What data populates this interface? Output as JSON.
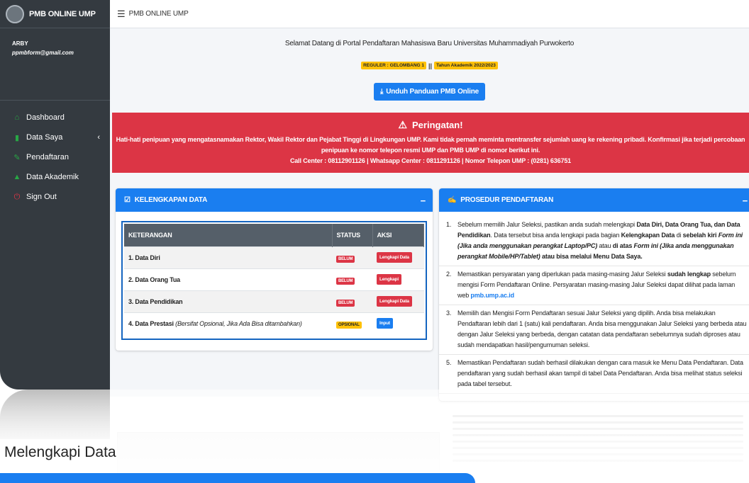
{
  "brand": {
    "title": "PMB ONLINE UMP"
  },
  "user": {
    "name": "ARBY",
    "email": "ppmbform@gmail.com"
  },
  "nav": [
    {
      "label": "Dashboard",
      "icon": "home-icon",
      "color": "#28a745"
    },
    {
      "label": "Data Saya",
      "icon": "book-icon",
      "color": "#28a745",
      "has_chevron": true
    },
    {
      "label": "Pendaftaran",
      "icon": "edit-icon",
      "color": "#28a745"
    },
    {
      "label": "Data Akademik",
      "icon": "graduation-cap-icon",
      "color": "#28a745"
    },
    {
      "label": "Sign Out",
      "icon": "power-icon",
      "color": "#dc3545"
    }
  ],
  "topbar": {
    "title": "PMB ONLINE UMP"
  },
  "welcome": "Selamat Datang di Portal Pendaftaran Mahasiswa Baru Universitas Muhammadiyah Purwokerto",
  "badges": {
    "left": "REGULER : GELOMBANG 1",
    "separator": "||",
    "right": "Tahun Akademik 2022/2023"
  },
  "download_button": "Unduh Panduan PMB Online",
  "warning": {
    "title": "Peringatan!",
    "line1": "Hati-hati penipuan yang mengatasnamakan Rektor, Wakil Rektor dan Pejabat Tinggi di Lingkungan UMP. Kami tidak pernah meminta mentransfer sejumlah uang ke rekening pribadi. Konfirmasi jika terjadi percobaan",
    "line2": "penipuan ke nomor telepon resmi UMP dan PMB UMP di nomor berikut ini.",
    "line3": "Call Center : 08112901126 | Whatsapp Center : 0811291126 | Nomor Telepon UMP : (0281) 636751"
  },
  "kelengkapan": {
    "title": "KELENGKAPAN DATA",
    "collapse": "−",
    "headers": {
      "keterangan": "KETERANGAN",
      "status": "STATUS",
      "aksi": "AKSI"
    },
    "rows": [
      {
        "label": "1. Data Diri",
        "note": "",
        "status": "BELUM",
        "status_type": "red",
        "action": "Lengkapi Data",
        "action_type": "red"
      },
      {
        "label": "2. Data Orang Tua",
        "note": "",
        "status": "BELUM",
        "status_type": "red",
        "action": "Lengkapi",
        "action_type": "red"
      },
      {
        "label": "3. Data Pendidikan",
        "note": "",
        "status": "BELUM",
        "status_type": "red",
        "action": "Lengkapi Data",
        "action_type": "red"
      },
      {
        "label": "4. Data Prestasi",
        "note": "(Bersifat Opsional, Jika Ada Bisa ditambahkan)",
        "status": "OPSIONAL",
        "status_type": "yellow",
        "action": "Input",
        "action_type": "blue"
      }
    ]
  },
  "prosedur": {
    "title": "PROSEDUR PENDAFTARAN",
    "collapse": "−",
    "items": [
      {
        "num": "1.",
        "parts": [
          {
            "t": "Sebelum memilih Jalur Seleksi, pastikan anda sudah melengkapi ",
            "s": ""
          },
          {
            "t": "Data Diri, Data Orang Tua, dan Data Pendidikan",
            "s": "b"
          },
          {
            "t": ". Data tersebut bisa anda lengkapi pada bagian ",
            "s": ""
          },
          {
            "t": "Kelengkapan Data",
            "s": "b"
          },
          {
            "t": " di ",
            "s": ""
          },
          {
            "t": "sebelah kiri ",
            "s": "b"
          },
          {
            "t": "Form ini (Jika anda menggunakan perangkat Laptop/PC)",
            "s": "bi"
          },
          {
            "t": " atau ",
            "s": ""
          },
          {
            "t": "di atas ",
            "s": "b"
          },
          {
            "t": "Form ini (Jika anda menggunakan perangkat Mobile/HP/Tablet)",
            "s": "bi"
          },
          {
            "t": " atau bisa melalui Menu Data Saya.",
            "s": "b"
          }
        ]
      },
      {
        "num": "2.",
        "parts": [
          {
            "t": "Memastikan persyaratan yang diperlukan pada masing-masing Jalur Seleksi ",
            "s": ""
          },
          {
            "t": "sudah lengkap",
            "s": "b"
          },
          {
            "t": " sebelum mengisi Form Pendaftaran Online. Persyaratan masing-masing Jalur Seleksi dapat dilihat pada laman web ",
            "s": ""
          },
          {
            "t": "pmb.ump.ac.id",
            "s": "a"
          }
        ]
      },
      {
        "num": "3.",
        "parts": [
          {
            "t": "Memilih dan Mengisi Form Pendaftaran sesuai Jalur Seleksi yang dipilih. Anda bisa melakukan Pendaftaran lebih dari 1 (satu) kali pendaftaran. Anda bisa menggunakan Jalur Seleksi yang berbeda atau dengan Jalur Seleksi yang berbeda, dengan catatan data pendaftaran sebelumnya sudah diproses atau sudah mendapatkan hasil/pengumuman seleksi.",
            "s": ""
          }
        ]
      },
      {
        "num": "5.",
        "parts": [
          {
            "t": "Memastikan Pendaftaran sudah berhasil dilakukan dengan cara masuk ke Menu Data Pendaftaran. Data pendaftaran yang sudah berhasil akan tampil di tabel Data Pendaftaran. Anda bisa melihat status seleksi pada tabel tersebut.",
            "s": ""
          }
        ]
      }
    ]
  },
  "caption": "Melengkapi Data",
  "colors": {
    "sidebar": "#343a40",
    "primary": "#1a7ef0",
    "danger": "#dc3545",
    "warning": "#ffc107",
    "table_head": "#555f69"
  }
}
